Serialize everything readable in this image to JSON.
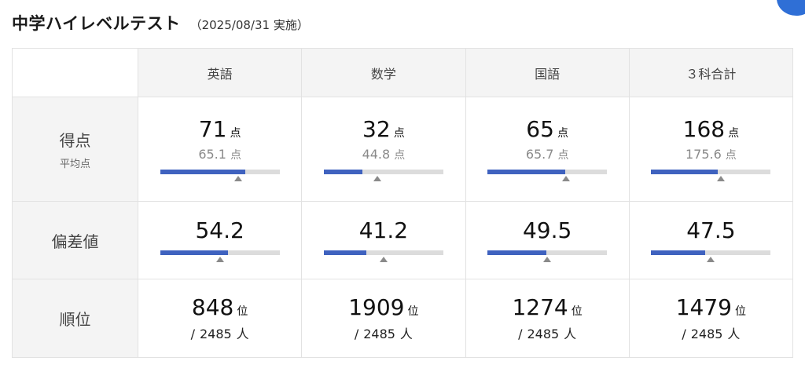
{
  "header": {
    "title": "中学ハイレベルテスト",
    "date": "（2025/08/31 実施）"
  },
  "columns": [
    "英語",
    "数学",
    "国語",
    "３科合計"
  ],
  "rows": {
    "score_label": "得点",
    "average_label": "平均点",
    "deviation_label": "偏差値",
    "rank_label": "順位"
  },
  "units": {
    "point": "点",
    "rank": "位",
    "person": "人",
    "slash": "/"
  },
  "subjects": [
    {
      "score": "71",
      "average": "65.1",
      "score_fraction": 0.71,
      "average_fraction": 0.651,
      "deviation": "54.2",
      "deviation_fraction": 0.571,
      "deviation_mark_fraction": 0.5,
      "rank": "848",
      "total": "2485"
    },
    {
      "score": "32",
      "average": "44.8",
      "score_fraction": 0.32,
      "average_fraction": 0.448,
      "deviation": "41.2",
      "deviation_fraction": 0.356,
      "deviation_mark_fraction": 0.5,
      "rank": "1909",
      "total": "2485"
    },
    {
      "score": "65",
      "average": "65.7",
      "score_fraction": 0.65,
      "average_fraction": 0.657,
      "deviation": "49.5",
      "deviation_fraction": 0.493,
      "deviation_mark_fraction": 0.5,
      "rank": "1274",
      "total": "2485"
    },
    {
      "score": "168",
      "average": "175.6",
      "score_fraction": 0.56,
      "average_fraction": 0.585,
      "deviation": "47.5",
      "deviation_fraction": 0.454,
      "deviation_mark_fraction": 0.5,
      "rank": "1479",
      "total": "2485"
    }
  ],
  "colors": {
    "bar_fill": "#3f62bf",
    "bar_track": "#dcdcdc",
    "marker": "#8a8a8a",
    "header_bg": "#f4f4f4",
    "accent": "#2f6fd6"
  }
}
